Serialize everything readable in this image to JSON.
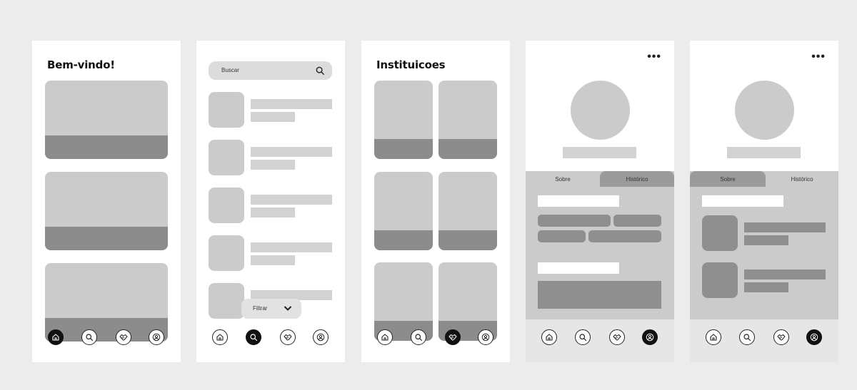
{
  "screens": {
    "home": {
      "title": "Bem-vindo!"
    },
    "search": {
      "search_placeholder": "Buscar",
      "filter_label": "Filtrar"
    },
    "institutions": {
      "title": "Instituicoes"
    },
    "profile_about": {
      "more_label": "•••",
      "tab_about": "Sobre",
      "tab_history": "Histórico"
    },
    "profile_history": {
      "more_label": "•••",
      "tab_about": "Sobre",
      "tab_history": "Histórico"
    }
  },
  "colors": {
    "background": "#ececec",
    "frame": "#ffffff",
    "placeholder": "#cbcbcb",
    "placeholder_dark": "#8c8c8c",
    "active_nav": "#111111"
  },
  "nav_icons": [
    "home-icon",
    "search-icon",
    "handshake-icon",
    "user-icon"
  ]
}
